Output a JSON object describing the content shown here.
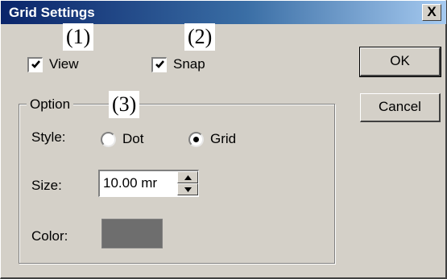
{
  "window": {
    "title": "Grid Settings",
    "close_label": "X"
  },
  "callouts": [
    "(1)",
    "(2)",
    "(3)"
  ],
  "checkboxes": {
    "view": {
      "label": "View",
      "checked": true
    },
    "snap": {
      "label": "Snap",
      "checked": true
    }
  },
  "buttons": {
    "ok": "OK",
    "cancel": "Cancel"
  },
  "option_group": {
    "legend": "Option",
    "style_label": "Style:",
    "style_options": [
      {
        "label": "Dot",
        "selected": false
      },
      {
        "label": "Grid",
        "selected": true
      }
    ],
    "size_label": "Size:",
    "size_value": "10.00 mr",
    "color_label": "Color:",
    "color_value": "#6e6e6e"
  },
  "icons": {
    "close": "close-icon",
    "checkmark": "checkmark-icon",
    "spin_up": "arrow-up-icon",
    "spin_down": "arrow-down-icon"
  }
}
